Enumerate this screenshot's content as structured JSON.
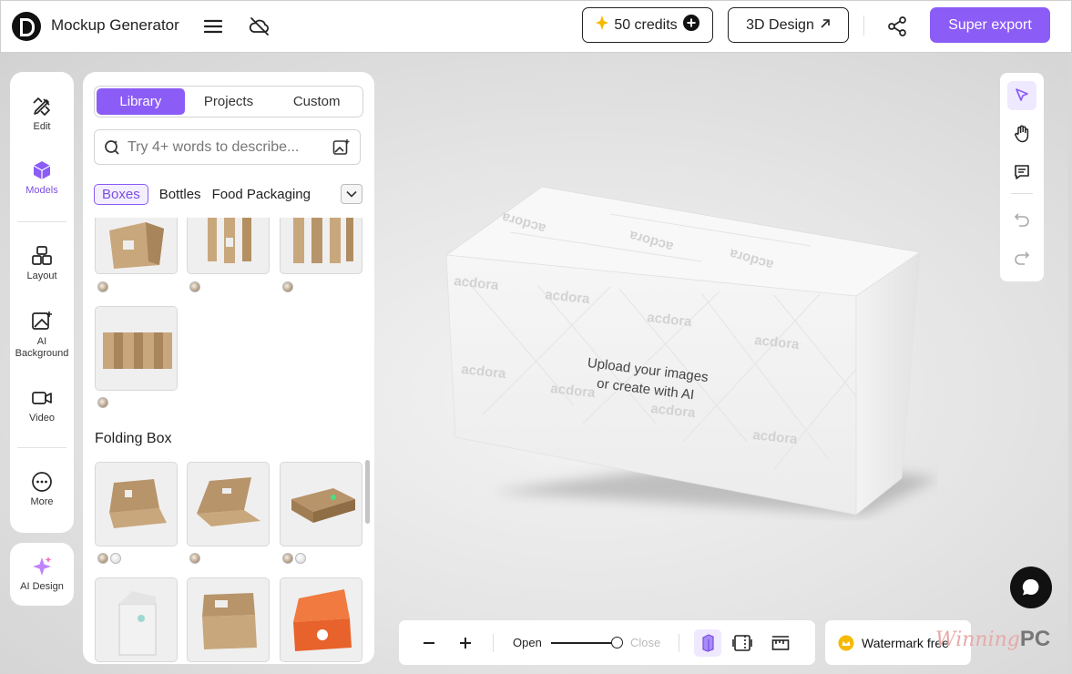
{
  "header": {
    "app_title": "Mockup Generator",
    "credits_label": "50 credits",
    "design_label": "3D Design",
    "export_label": "Super export"
  },
  "left_rail": {
    "items": [
      {
        "label": "Edit",
        "icon": "edit-icon"
      },
      {
        "label": "Models",
        "icon": "cube-icon"
      },
      {
        "label": "Layout",
        "icon": "layout-icon"
      },
      {
        "label": "AI Background",
        "icon": "ai-background-icon"
      },
      {
        "label": "Video",
        "icon": "video-icon"
      },
      {
        "label": "More",
        "icon": "more-icon"
      }
    ],
    "ai_design_label": "AI Design"
  },
  "panel": {
    "tabs": [
      "Library",
      "Projects",
      "Custom"
    ],
    "search_placeholder": "Try 4+ words to describe...",
    "categories": [
      "Boxes",
      "Bottles",
      "Food Packaging"
    ],
    "section_title": "Folding Box"
  },
  "canvas": {
    "prompt_line1": "Upload your images",
    "prompt_line2": "or create with AI",
    "brand_pattern": "acdora"
  },
  "bottom_bar": {
    "open_label": "Open",
    "close_label": "Close",
    "open_level": 1.0
  },
  "watermark_button": "Watermark free",
  "site_watermark": {
    "script": "Winning",
    "bold": "PC"
  },
  "colors": {
    "accent": "#8b5cf6",
    "chip_bg": "#f4efff"
  }
}
